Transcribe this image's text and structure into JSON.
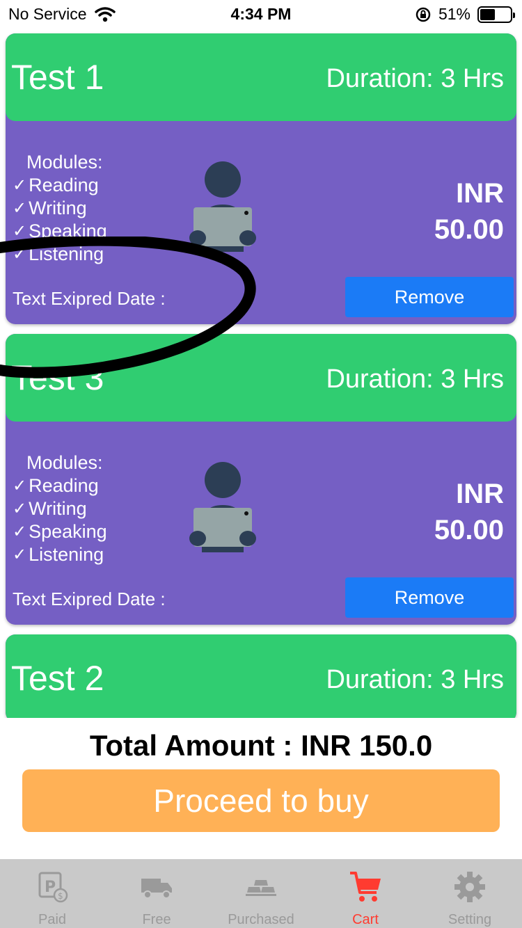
{
  "status_bar": {
    "carrier": "No Service",
    "time": "4:34 PM",
    "battery_text": "51%",
    "battery_level": 0.51
  },
  "cards": [
    {
      "title": "Test 1",
      "duration": "Duration: 3 Hrs",
      "modules_title": "Modules:",
      "modules": [
        "Reading",
        "Writing",
        "Speaking",
        "Listening"
      ],
      "currency": "INR",
      "amount": "50.00",
      "expired_label": "Text Exipred Date :",
      "remove_label": "Remove"
    },
    {
      "title": "Test 3",
      "duration": "Duration: 3 Hrs",
      "modules_title": "Modules:",
      "modules": [
        "Reading",
        "Writing",
        "Speaking",
        "Listening"
      ],
      "currency": "INR",
      "amount": "50.00",
      "expired_label": "Text Exipred Date :",
      "remove_label": "Remove"
    },
    {
      "title": "Test 2",
      "duration": "Duration: 3 Hrs"
    }
  ],
  "footer": {
    "total": "Total Amount : INR 150.0",
    "proceed_label": "Proceed to buy"
  },
  "tabs": [
    {
      "label": "Paid",
      "icon": "paid-icon"
    },
    {
      "label": "Free",
      "icon": "free-truck-icon"
    },
    {
      "label": "Purchased",
      "icon": "gold-bars-icon"
    },
    {
      "label": "Cart",
      "icon": "cart-icon",
      "active": true
    },
    {
      "label": "Setting",
      "icon": "gear-icon"
    }
  ],
  "colors": {
    "card_header": "#30cd71",
    "card_body": "#755fc4",
    "remove_button": "#1b7bf6",
    "buy_button": "#ffb156",
    "active_tab": "#ff3b30"
  }
}
